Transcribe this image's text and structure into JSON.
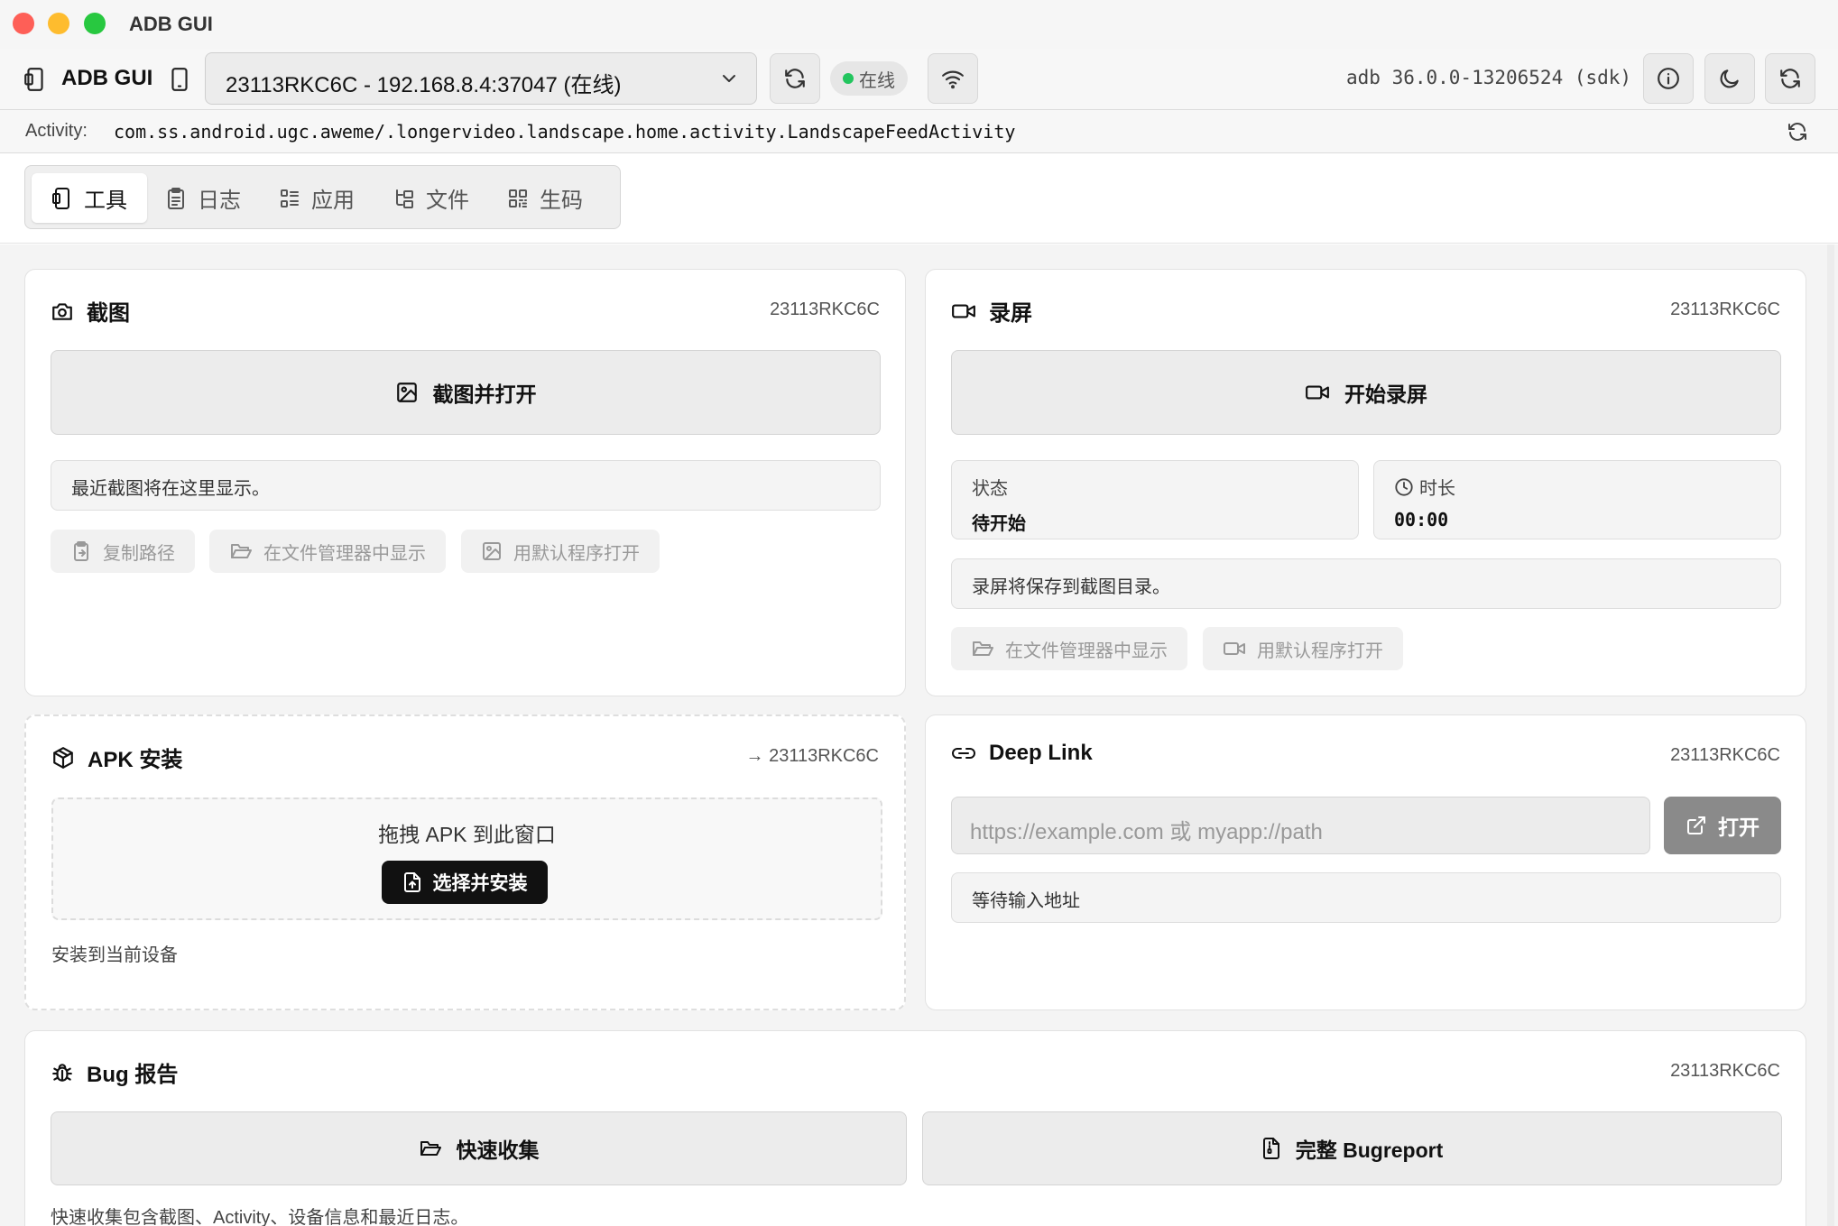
{
  "window": {
    "title": "ADB GUI"
  },
  "toolbar": {
    "brand": "ADB GUI",
    "device_select_value": "23113RKC6C - 192.168.8.4:37047 (在线)",
    "status_text": "在线",
    "status_color": "#22c55e",
    "adb_version": "adb 36.0.0-13206524 (sdk)"
  },
  "activity": {
    "label": "Activity:",
    "value": "com.ss.android.ugc.aweme/.longervideo.landscape.home.activity.LandscapeFeedActivity"
  },
  "tabs": [
    {
      "label": "工具",
      "icon": "phone-icon",
      "active": true
    },
    {
      "label": "日志",
      "icon": "clipboard-icon",
      "active": false
    },
    {
      "label": "应用",
      "icon": "list-icon",
      "active": false
    },
    {
      "label": "文件",
      "icon": "folder-tree-icon",
      "active": false
    },
    {
      "label": "生码",
      "icon": "qr-code-icon",
      "active": false
    }
  ],
  "screenshot": {
    "title": "截图",
    "device": "23113RKC6C",
    "primary_button": "截图并打开",
    "info": "最近截图将在这里显示。",
    "actions": [
      "复制路径",
      "在文件管理器中显示",
      "用默认程序打开"
    ]
  },
  "record": {
    "title": "录屏",
    "device": "23113RKC6C",
    "primary_button": "开始录屏",
    "status_label": "状态",
    "status_value": "待开始",
    "duration_label": "时长",
    "duration_value": "00:00",
    "info": "录屏将保存到截图目录。",
    "actions": [
      "在文件管理器中显示",
      "用默认程序打开"
    ]
  },
  "apk": {
    "title": "APK 安装",
    "device": "→ 23113RKC6C",
    "drop_text": "拖拽 APK 到此窗口",
    "install_button": "选择并安装",
    "note": "安装到当前设备"
  },
  "deeplink": {
    "title": "Deep Link",
    "device": "23113RKC6C",
    "input_placeholder": "https://example.com 或 myapp://path",
    "input_value": "",
    "open_button": "打开",
    "status": "等待输入地址"
  },
  "bug": {
    "title": "Bug 报告",
    "device": "23113RKC6C",
    "quick_button": "快速收集",
    "full_button": "完整 Bugreport",
    "note": "快速收集包含截图、Activity、设备信息和最近日志。"
  }
}
